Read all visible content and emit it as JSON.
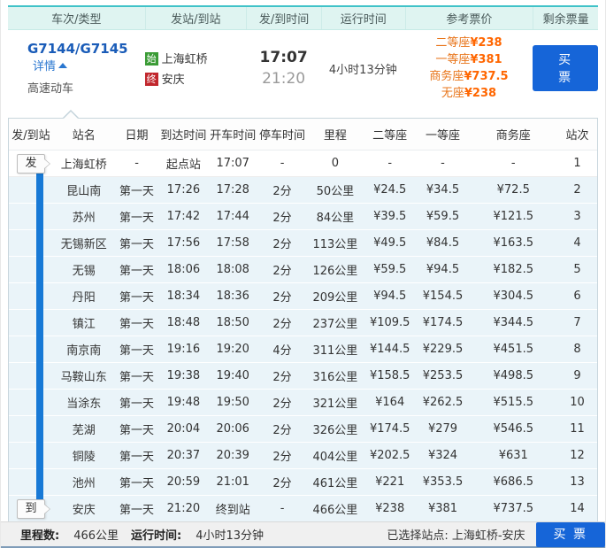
{
  "colors": {
    "header_teal": "#40c2c8",
    "accent_blue": "#1665d8",
    "link_blue": "#1a5cb8",
    "price_orange": "#ff6600",
    "route_blue": "#1779d6",
    "badge_green": "#3a9b35",
    "badge_red": "#c1272d",
    "row_highlight": "#eaf4f9"
  },
  "summary": {
    "columns": [
      "车次/类型",
      "发站/到站",
      "发/到时间",
      "运行时间",
      "参考票价",
      "剩余票量"
    ],
    "train": {
      "number": "G7144/G7145",
      "detail_link": "详情",
      "type": "高速动车",
      "origin_badge": "始",
      "origin": "上海虹桥",
      "dest_badge": "终",
      "destination": "安庆",
      "depart_time": "17:07",
      "arrive_time": "21:20",
      "duration": "4小时13分钟",
      "fares": [
        {
          "label": "二等座",
          "amount": "¥238"
        },
        {
          "label": "一等座",
          "amount": "¥381"
        },
        {
          "label": "商务座",
          "amount": "¥737.5"
        },
        {
          "label": "无座",
          "amount": "¥238"
        }
      ],
      "buy_label": "买 票"
    }
  },
  "detail": {
    "headers": [
      "发/到站",
      "站名",
      "日期",
      "到达时间",
      "开车时间",
      "停车时间",
      "里程",
      "二等座",
      "一等座",
      "商务座",
      "站次"
    ],
    "depart_marker": "发",
    "arrive_marker": "到",
    "rows": [
      {
        "cells": [
          "上海虹桥",
          "-",
          "起点站",
          "17:07",
          "-",
          "0",
          "-",
          "-",
          "-",
          "1"
        ]
      },
      {
        "cells": [
          "昆山南",
          "第一天",
          "17:26",
          "17:28",
          "2分",
          "50公里",
          "¥24.5",
          "¥34.5",
          "¥72.5",
          "2"
        ]
      },
      {
        "cells": [
          "苏州",
          "第一天",
          "17:42",
          "17:44",
          "2分",
          "84公里",
          "¥39.5",
          "¥59.5",
          "¥121.5",
          "3"
        ]
      },
      {
        "cells": [
          "无锡新区",
          "第一天",
          "17:56",
          "17:58",
          "2分",
          "113公里",
          "¥49.5",
          "¥84.5",
          "¥163.5",
          "4"
        ]
      },
      {
        "cells": [
          "无锡",
          "第一天",
          "18:06",
          "18:08",
          "2分",
          "126公里",
          "¥59.5",
          "¥94.5",
          "¥182.5",
          "5"
        ]
      },
      {
        "cells": [
          "丹阳",
          "第一天",
          "18:34",
          "18:36",
          "2分",
          "209公里",
          "¥94.5",
          "¥154.5",
          "¥304.5",
          "6"
        ]
      },
      {
        "cells": [
          "镇江",
          "第一天",
          "18:48",
          "18:50",
          "2分",
          "237公里",
          "¥109.5",
          "¥174.5",
          "¥344.5",
          "7"
        ]
      },
      {
        "cells": [
          "南京南",
          "第一天",
          "19:16",
          "19:20",
          "4分",
          "311公里",
          "¥144.5",
          "¥229.5",
          "¥451.5",
          "8"
        ]
      },
      {
        "cells": [
          "马鞍山东",
          "第一天",
          "19:38",
          "19:40",
          "2分",
          "316公里",
          "¥158.5",
          "¥253.5",
          "¥498.5",
          "9"
        ]
      },
      {
        "cells": [
          "当涂东",
          "第一天",
          "19:48",
          "19:50",
          "2分",
          "321公里",
          "¥164",
          "¥262.5",
          "¥515.5",
          "10"
        ]
      },
      {
        "cells": [
          "芜湖",
          "第一天",
          "20:04",
          "20:06",
          "2分",
          "326公里",
          "¥174.5",
          "¥279",
          "¥546.5",
          "11"
        ]
      },
      {
        "cells": [
          "铜陵",
          "第一天",
          "20:37",
          "20:39",
          "2分",
          "404公里",
          "¥202.5",
          "¥324",
          "¥631",
          "12"
        ]
      },
      {
        "cells": [
          "池州",
          "第一天",
          "20:59",
          "21:01",
          "2分",
          "461公里",
          "¥221",
          "¥353.5",
          "¥686.5",
          "13"
        ]
      },
      {
        "cells": [
          "安庆",
          "第一天",
          "21:20",
          "终到站",
          "-",
          "466公里",
          "¥238",
          "¥381",
          "¥737.5",
          "14"
        ]
      }
    ]
  },
  "footer": {
    "mileage_label": "里程数:",
    "mileage": "466公里",
    "duration_label": "运行时间:",
    "duration": "4小时13分钟",
    "selected_label": "已选择站点:",
    "selected": "上海虹桥-安庆",
    "buy_label": "买 票"
  }
}
